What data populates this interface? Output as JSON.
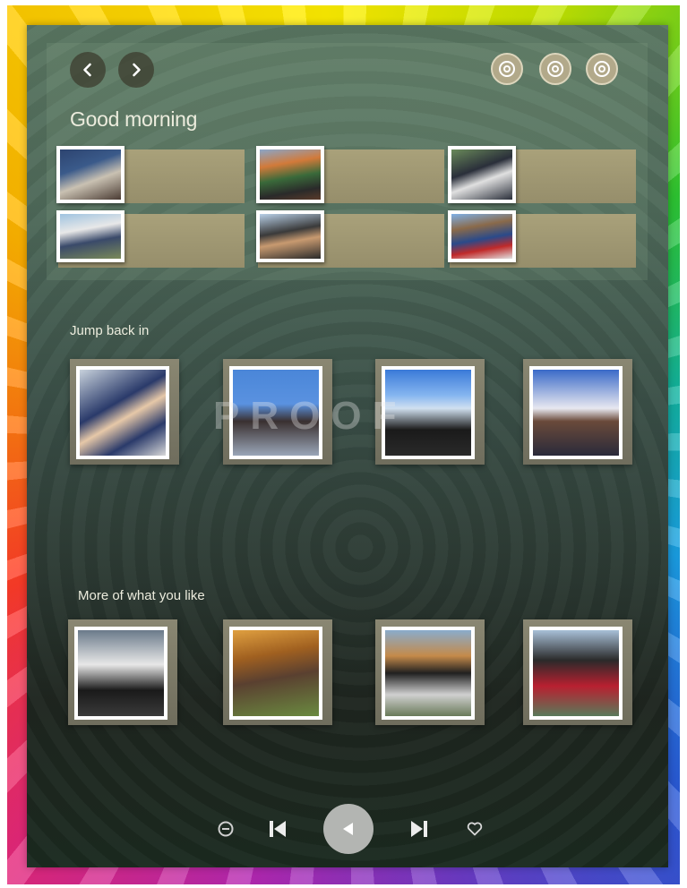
{
  "header": {
    "back_icon": "chevron-left-icon",
    "forward_icon": "chevron-right-icon",
    "action_icons": [
      "ring-icon",
      "ring-icon",
      "ring-icon"
    ]
  },
  "greeting": "Good morning",
  "shortcuts": [
    {
      "photo": "group-photo"
    },
    {
      "photo": "group-photo"
    },
    {
      "photo": "group-photo"
    },
    {
      "photo": "group-photo"
    },
    {
      "photo": "group-photo"
    },
    {
      "photo": "group-photo"
    }
  ],
  "jump_back_in": {
    "title": "Jump back in",
    "items": [
      {
        "photo": "photo"
      },
      {
        "photo": "photo"
      },
      {
        "photo": "photo"
      },
      {
        "photo": "photo"
      }
    ]
  },
  "more_you_like": {
    "title": "More of what you like",
    "items": [
      {
        "photo": "photo"
      },
      {
        "photo": "photo"
      },
      {
        "photo": "photo"
      },
      {
        "photo": "photo"
      }
    ]
  },
  "watermark": "PROOF",
  "player": {
    "icons": [
      "minus-circle-icon",
      "skip-back-icon",
      "play-icon",
      "skip-forward-icon",
      "heart-icon"
    ]
  },
  "colors": {
    "panel_top": "#5a7762",
    "panel_bottom": "#1b2a20",
    "tile": "#a9a17a",
    "text": "#ececdd"
  }
}
